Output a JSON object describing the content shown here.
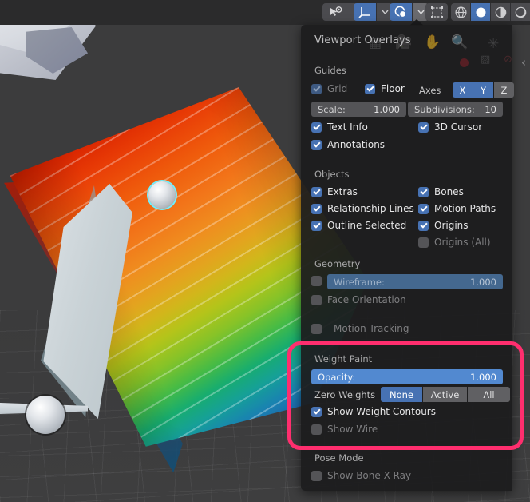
{
  "app": {
    "editor": "3D Viewport",
    "mode": "Weight Paint"
  },
  "header": {
    "tools": [
      {
        "name": "visibility-selectability-button",
        "icon": "cursor-eye-icon",
        "state": "normal",
        "caret": true
      },
      {
        "name": "transform-orientation-button",
        "icon": "axis-gizmo-icon",
        "state": "active",
        "caret": true
      },
      {
        "name": "viewport-overlays-button",
        "icon": "overlays-circles-icon",
        "state": "active",
        "caret": true
      },
      {
        "name": "xray-toggle-button",
        "icon": "xray-cube-icon",
        "state": "normal",
        "caret": false
      }
    ],
    "shading": [
      {
        "name": "shading-wireframe-button",
        "icon": "wireframe-globe-icon",
        "state": "normal"
      },
      {
        "name": "shading-solid-button",
        "icon": "solid-sphere-icon",
        "state": "active"
      },
      {
        "name": "shading-material-preview-button",
        "icon": "material-sphere-icon",
        "state": "normal"
      },
      {
        "name": "shading-rendered-button",
        "icon": "rendered-sphere-icon",
        "state": "normal"
      }
    ],
    "shading_caret": "⌄"
  },
  "panel": {
    "title": "Viewport Overlays",
    "collapse_chevron": "‹",
    "ghost_icons": [
      "grid-ghost-icon",
      "camera-ghost-icon",
      "hand-ghost-icon",
      "zoom-ghost-icon",
      "light-ghost-icon"
    ],
    "sections": {
      "guides": {
        "label": "Guides",
        "grid": {
          "label": "Grid",
          "checked": true,
          "disabled": true
        },
        "floor": {
          "label": "Floor",
          "checked": true,
          "disabled": false
        },
        "axes_label": "Axes",
        "axes": [
          {
            "label": "X",
            "active": true
          },
          {
            "label": "Y",
            "active": true
          },
          {
            "label": "Z",
            "active": false
          }
        ],
        "scale": {
          "label": "Scale:",
          "value": "1.000",
          "disabled": true
        },
        "subdivisions": {
          "label": "Subdivisions:",
          "value": "10",
          "disabled": true
        },
        "text_info": {
          "label": "Text Info",
          "checked": true,
          "disabled": false
        },
        "cursor_3d": {
          "label": "3D Cursor",
          "checked": true,
          "disabled": false
        },
        "annotations": {
          "label": "Annotations",
          "checked": true,
          "disabled": false
        }
      },
      "objects": {
        "label": "Objects",
        "extras": {
          "label": "Extras",
          "checked": true,
          "disabled": false
        },
        "bones": {
          "label": "Bones",
          "checked": true,
          "disabled": false
        },
        "relationship_lines": {
          "label": "Relationship Lines",
          "checked": true,
          "disabled": false
        },
        "motion_paths": {
          "label": "Motion Paths",
          "checked": true,
          "disabled": false
        },
        "outline_selected": {
          "label": "Outline Selected",
          "checked": true,
          "disabled": false
        },
        "origins": {
          "label": "Origins",
          "checked": true,
          "disabled": false
        },
        "origins_all": {
          "label": "Origins (All)",
          "checked": false,
          "disabled": true
        }
      },
      "geometry": {
        "label": "Geometry",
        "wireframe_toggle": {
          "checked": false,
          "disabled": false
        },
        "wireframe": {
          "label": "Wireframe:",
          "value": "1.000",
          "disabled": true
        },
        "face_orientation": {
          "label": "Face Orientation",
          "checked": false,
          "disabled": false
        },
        "motion_tracking": {
          "label": "Motion Tracking",
          "checked": false,
          "disabled": false
        }
      },
      "weight_paint": {
        "label": "Weight Paint",
        "opacity": {
          "label": "Opacity:",
          "value": "1.000"
        },
        "zero_weights_label": "Zero Weights",
        "zero_weights_options": [
          {
            "label": "None",
            "active": true
          },
          {
            "label": "Active",
            "active": false
          },
          {
            "label": "All",
            "active": false
          }
        ],
        "show_weight_contours": {
          "label": "Show Weight Contours",
          "checked": true,
          "disabled": false
        },
        "show_wire": {
          "label": "Show Wire",
          "checked": false,
          "disabled": true
        }
      },
      "pose_mode": {
        "label": "Pose Mode",
        "show_bone_xray": {
          "label": "Show Bone X-Ray",
          "checked": false,
          "disabled": false
        }
      }
    }
  },
  "annotation": {
    "highlight_color": "#ff2e6e",
    "highlight_target": "weight-paint-section"
  },
  "colors": {
    "accent_blue": "#4772b3",
    "slider_blue": "#5289d0",
    "panel_bg": "#1d1d1e",
    "header_bg": "#2b2b2c",
    "viewport_bg": "#3c3c3d",
    "highlight_pink": "#ff2e6e"
  }
}
